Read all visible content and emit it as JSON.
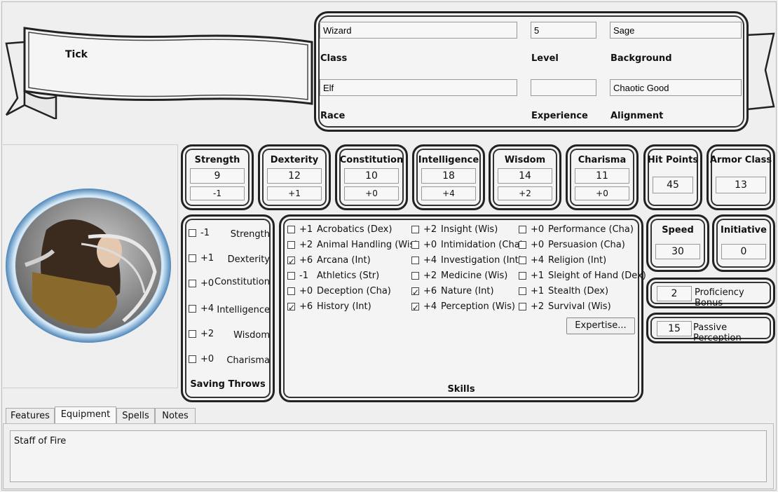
{
  "character": {
    "name": "Tick",
    "class_value": "Wizard",
    "class_label": "Class",
    "level_value": "5",
    "level_label": "Level",
    "background_value": "Sage",
    "background_label": "Background",
    "race_value": "Elf",
    "race_label": "Race",
    "experience_value": "",
    "experience_label": "Experience",
    "alignment_value": "Chaotic Good",
    "alignment_label": "Alignment"
  },
  "abilities": [
    {
      "name": "Strength",
      "score": "9",
      "mod": "-1"
    },
    {
      "name": "Dexterity",
      "score": "12",
      "mod": "+1"
    },
    {
      "name": "Constitution",
      "score": "10",
      "mod": "+0"
    },
    {
      "name": "Intelligence",
      "score": "18",
      "mod": "+4"
    },
    {
      "name": "Wisdom",
      "score": "14",
      "mod": "+2"
    },
    {
      "name": "Charisma",
      "score": "11",
      "mod": "+0"
    }
  ],
  "hit_points": {
    "label": "Hit Points",
    "value": "45"
  },
  "armor_class": {
    "label": "Armor Class",
    "value": "13"
  },
  "speed": {
    "label": "Speed",
    "value": "30"
  },
  "initiative": {
    "label": "Initiative",
    "value": "0"
  },
  "proficiency": {
    "label": "Proficiency Bonus",
    "value": "2"
  },
  "passive": {
    "label": "Passive Perception",
    "value": "15"
  },
  "saving_throws": {
    "title": "Saving Throws",
    "items": [
      {
        "mod": "-1",
        "name": "Strength",
        "checked": false
      },
      {
        "mod": "+1",
        "name": "Dexterity",
        "checked": false
      },
      {
        "mod": "+0",
        "name": "Constitution",
        "checked": false
      },
      {
        "mod": "+4",
        "name": "Intelligence",
        "checked": false
      },
      {
        "mod": "+2",
        "name": "Wisdom",
        "checked": false
      },
      {
        "mod": "+0",
        "name": "Charisma",
        "checked": false
      }
    ]
  },
  "skills": {
    "title": "Skills",
    "expertise_label": "Expertise...",
    "col1": [
      {
        "mod": "+1",
        "name": "Acrobatics (Dex)",
        "checked": false
      },
      {
        "mod": "+2",
        "name": "Animal Handling (Wis)",
        "checked": false
      },
      {
        "mod": "+6",
        "name": "Arcana (Int)",
        "checked": true
      },
      {
        "mod": "-1",
        "name": "Athletics (Str)",
        "checked": false
      },
      {
        "mod": "+0",
        "name": "Deception (Cha)",
        "checked": false
      },
      {
        "mod": "+6",
        "name": "History (Int)",
        "checked": true
      }
    ],
    "col2": [
      {
        "mod": "+2",
        "name": "Insight (Wis)",
        "checked": false
      },
      {
        "mod": "+0",
        "name": "Intimidation (Cha)",
        "checked": false
      },
      {
        "mod": "+4",
        "name": "Investigation (Int)",
        "checked": false
      },
      {
        "mod": "+2",
        "name": "Medicine (Wis)",
        "checked": false
      },
      {
        "mod": "+6",
        "name": "Nature (Int)",
        "checked": true
      },
      {
        "mod": "+4",
        "name": "Perception (Wis)",
        "checked": true
      }
    ],
    "col3": [
      {
        "mod": "+0",
        "name": "Performance (Cha)",
        "checked": false
      },
      {
        "mod": "+0",
        "name": "Persuasion (Cha)",
        "checked": false
      },
      {
        "mod": "+4",
        "name": "Religion (Int)",
        "checked": false
      },
      {
        "mod": "+1",
        "name": "Sleight of Hand (Dex)",
        "checked": false
      },
      {
        "mod": "+1",
        "name": "Stealth (Dex)",
        "checked": false
      },
      {
        "mod": "+2",
        "name": "Survival (Wis)",
        "checked": false
      }
    ]
  },
  "tabs": [
    {
      "label": "Features",
      "active": false
    },
    {
      "label": "Equipment",
      "active": true
    },
    {
      "label": "Spells",
      "active": false
    },
    {
      "label": "Notes",
      "active": false
    }
  ],
  "tab_content": "Staff of Fire"
}
